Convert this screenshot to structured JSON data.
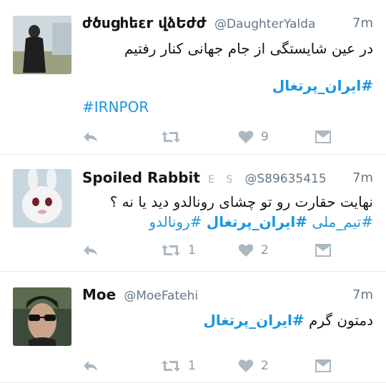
{
  "tweets": [
    {
      "name": "ժծսցհեεr վձԵժժ",
      "handle": "@DaughterYalda",
      "time": "7m",
      "text": "در عین شایستگی از جام جهانی کنار رفتیم",
      "tags_rtl": "#ایران_پرتغال",
      "tags_ltr": "#IRNPOR",
      "retweets": "",
      "likes": "9"
    },
    {
      "name": "Spoiled Rabbit",
      "badges": "E S",
      "handle": "@S89635415",
      "time": "7m",
      "text": "نهایت حقارت رو تو چشای رونالدو دید یا نه ؟",
      "tag1": "#تیم_ملی",
      "tag2": "#ایران_پرتغال",
      "tag3": "#رونالدو",
      "retweets": "1",
      "likes": "2"
    },
    {
      "name": "Moe",
      "handle": "@MoeFatehi",
      "time": "7m",
      "text": "دمتون گرم",
      "tag1": "#ایران_پرتغال",
      "retweets": "1",
      "likes": "2"
    }
  ],
  "icons": {
    "reply": "reply-icon",
    "retweet": "retweet-icon",
    "like": "heart-icon",
    "dm": "envelope-icon"
  },
  "colors": {
    "link": "#1b95e0",
    "muted": "#657786",
    "icon": "#aab8c2"
  }
}
